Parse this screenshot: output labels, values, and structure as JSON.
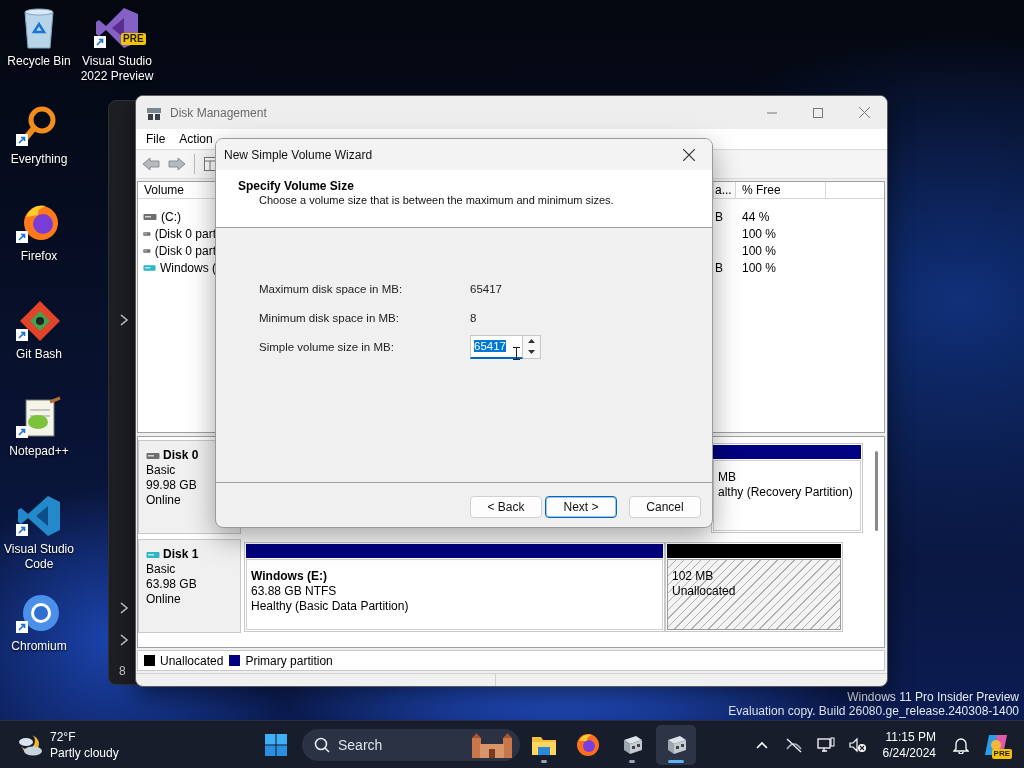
{
  "desktop": {
    "icon_columns": [
      [
        {
          "kind": "recycle-bin",
          "label": "Recycle Bin"
        },
        {
          "kind": "everything",
          "label": "Everything"
        },
        {
          "kind": "firefox",
          "label": "Firefox"
        },
        {
          "kind": "git-bash",
          "label": "Git Bash"
        },
        {
          "kind": "notepad",
          "label": "Notepad++"
        },
        {
          "kind": "vscode",
          "label": "Visual Studio Code"
        },
        {
          "kind": "chromium",
          "label": "Chromium"
        }
      ],
      [
        {
          "kind": "visual-studio",
          "label": "Visual Studio 2022 Preview",
          "badge": "PRE"
        }
      ]
    ],
    "watermark": [
      "Windows 11 Pro Insider Preview",
      "Evaluation copy. Build 26080.ge_release.240308-1400"
    ]
  },
  "background_window": {
    "footer_text": "8"
  },
  "disk_management": {
    "title": "Disk Management",
    "menu": [
      "File",
      "Action"
    ],
    "volume_list": {
      "columns": [
        "Volume",
        "a...",
        "% Free"
      ],
      "rows": [
        {
          "kind": "fixed",
          "volume": "(C:)",
          "capacity": "B",
          "free": "44 %"
        },
        {
          "kind": "fixed",
          "volume": "(Disk 0 part",
          "free": "100 %"
        },
        {
          "kind": "fixed",
          "volume": "(Disk 0 part",
          "free": "100 %"
        },
        {
          "kind": "removable",
          "volume": "Windows (",
          "capacity": "B",
          "free": "100 %"
        }
      ]
    },
    "disks": [
      {
        "kind": "fixed",
        "name": "Disk 0",
        "type": "Basic",
        "size": "99.98 GB",
        "status": "Online",
        "partitions": [
          {
            "kind": "primary",
            "lines": [
              "MB",
              "althy (Recovery Partition)"
            ]
          }
        ]
      },
      {
        "kind": "removable",
        "name": "Disk 1",
        "type": "Basic",
        "size": "63.98 GB",
        "status": "Online",
        "partitions": [
          {
            "kind": "primary",
            "name": "Windows  (E:)",
            "lines": [
              "63.88 GB NTFS",
              "Healthy (Basic Data Partition)"
            ]
          },
          {
            "kind": "unallocated",
            "lines": [
              "102 MB",
              "Unallocated"
            ]
          }
        ]
      }
    ],
    "legend": [
      {
        "label": "Unallocated",
        "color": "#000000"
      },
      {
        "label": "Primary partition",
        "color": "#000080"
      }
    ]
  },
  "wizard": {
    "title": "New Simple Volume Wizard",
    "heading": "Specify Volume Size",
    "subtitle": "Choose a volume size that is between the maximum and minimum sizes.",
    "fields": [
      {
        "kind": "readout",
        "label": "Maximum disk space in MB:",
        "value": "65417"
      },
      {
        "kind": "readout",
        "label": "Minimum disk space in MB:",
        "value": "8"
      },
      {
        "kind": "spinner",
        "label": "Simple volume size in MB:",
        "value": "65417",
        "selected": true
      }
    ],
    "buttons": [
      {
        "label": "< Back",
        "focused": false
      },
      {
        "label": "Next >",
        "focused": true
      },
      {
        "label": "Cancel",
        "focused": false
      }
    ]
  },
  "taskbar": {
    "weather": {
      "temperature": "72°F",
      "condition": "Partly cloudy"
    },
    "search": {
      "placeholder": "Search"
    },
    "apps": [
      {
        "kind": "explorer",
        "running": true,
        "selected": false
      },
      {
        "kind": "firefox",
        "running": false,
        "selected": false
      },
      {
        "kind": "disk-management",
        "running": true,
        "selected": false
      },
      {
        "kind": "disk-management",
        "running": true,
        "selected": true
      }
    ],
    "clock": {
      "time": "11:15 PM",
      "date": "6/24/2024"
    },
    "copilot_badge": "PRE"
  }
}
